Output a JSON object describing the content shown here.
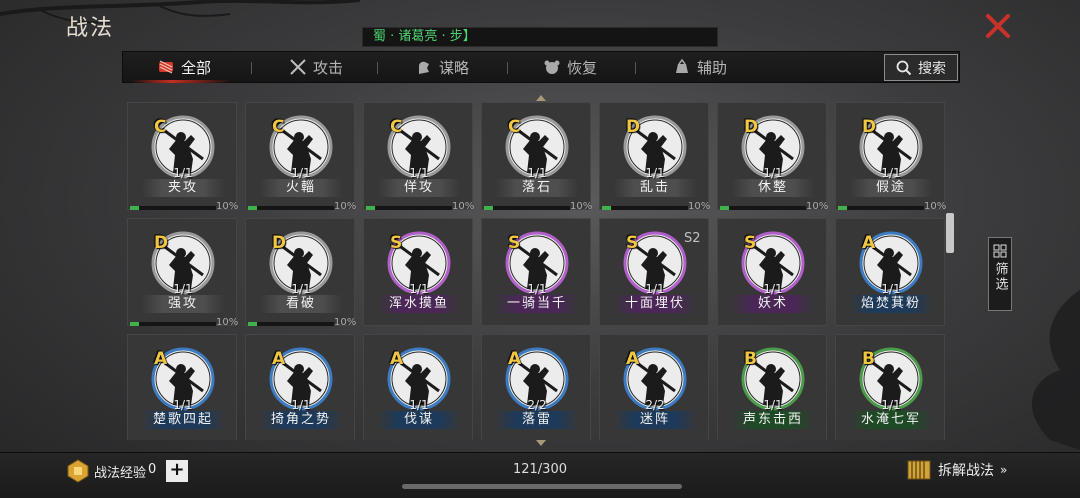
{
  "header": {
    "title": "战法",
    "hero_banner": "蜀 · 诸葛亮 · 步】"
  },
  "tabs": [
    {
      "label": "全部",
      "icon": "scroll-bundle-icon",
      "active": true
    },
    {
      "label": "攻击",
      "icon": "crossed-swords-icon",
      "active": false
    },
    {
      "label": "谋略",
      "icon": "hand-scroll-icon",
      "active": false
    },
    {
      "label": "恢复",
      "icon": "bear-head-icon",
      "active": false
    },
    {
      "label": "辅助",
      "icon": "pouch-icon",
      "active": false
    }
  ],
  "search": {
    "label": "搜索"
  },
  "filter": {
    "label": "筛选"
  },
  "colors": {
    "grade": "#f0c642",
    "ring_plain": "#9a9a9a",
    "ring_s": "#b060c8",
    "ring_a": "#3d7bc0",
    "ring_b": "#4a9a4a",
    "xp_fill": "#3fb34a",
    "close": "#c8322a"
  },
  "skills": [
    {
      "grade": "C",
      "count": "1/1",
      "name": "夹攻",
      "xp_label": "10%",
      "xp": 0.1,
      "quality": "plain",
      "season": ""
    },
    {
      "grade": "C",
      "count": "1/1",
      "name": "火輜",
      "xp_label": "10%",
      "xp": 0.1,
      "quality": "plain",
      "season": ""
    },
    {
      "grade": "C",
      "count": "1/1",
      "name": "佯攻",
      "xp_label": "10%",
      "xp": 0.1,
      "quality": "plain",
      "season": ""
    },
    {
      "grade": "C",
      "count": "1/1",
      "name": "落石",
      "xp_label": "10%",
      "xp": 0.1,
      "quality": "plain",
      "season": ""
    },
    {
      "grade": "D",
      "count": "1/1",
      "name": "乱击",
      "xp_label": "10%",
      "xp": 0.1,
      "quality": "plain",
      "season": ""
    },
    {
      "grade": "D",
      "count": "1/1",
      "name": "休整",
      "xp_label": "10%",
      "xp": 0.1,
      "quality": "plain",
      "season": ""
    },
    {
      "grade": "D",
      "count": "1/1",
      "name": "假途",
      "xp_label": "10%",
      "xp": 0.1,
      "quality": "plain",
      "season": ""
    },
    {
      "grade": "D",
      "count": "1/1",
      "name": "强攻",
      "xp_label": "10%",
      "xp": 0.1,
      "quality": "plain",
      "season": ""
    },
    {
      "grade": "D",
      "count": "1/1",
      "name": "看破",
      "xp_label": "10%",
      "xp": 0.1,
      "quality": "plain",
      "season": ""
    },
    {
      "grade": "S",
      "count": "1/1",
      "name": "浑水摸鱼",
      "xp_label": "",
      "xp": null,
      "quality": "s",
      "season": ""
    },
    {
      "grade": "S",
      "count": "1/1",
      "name": "一骑当千",
      "xp_label": "",
      "xp": null,
      "quality": "s",
      "season": ""
    },
    {
      "grade": "S",
      "count": "1/1",
      "name": "十面埋伏",
      "xp_label": "",
      "xp": null,
      "quality": "s",
      "season": "S2"
    },
    {
      "grade": "S",
      "count": "1/1",
      "name": "妖术",
      "xp_label": "",
      "xp": null,
      "quality": "s",
      "season": ""
    },
    {
      "grade": "A",
      "count": "1/1",
      "name": "焰焚萁粉",
      "xp_label": "",
      "xp": null,
      "quality": "a",
      "season": ""
    },
    {
      "grade": "A",
      "count": "1/1",
      "name": "楚歌四起",
      "xp_label": "",
      "xp": null,
      "quality": "a",
      "season": ""
    },
    {
      "grade": "A",
      "count": "1/1",
      "name": "掎角之势",
      "xp_label": "",
      "xp": null,
      "quality": "a",
      "season": ""
    },
    {
      "grade": "A",
      "count": "1/1",
      "name": "伐谋",
      "xp_label": "",
      "xp": null,
      "quality": "a",
      "season": ""
    },
    {
      "grade": "A",
      "count": "2/2",
      "name": "落雷",
      "xp_label": "",
      "xp": null,
      "quality": "a",
      "season": ""
    },
    {
      "grade": "A",
      "count": "2/2",
      "name": "迷阵",
      "xp_label": "",
      "xp": null,
      "quality": "a",
      "season": ""
    },
    {
      "grade": "B",
      "count": "1/1",
      "name": "声东击西",
      "xp_label": "",
      "xp": null,
      "quality": "b",
      "season": ""
    },
    {
      "grade": "B",
      "count": "1/1",
      "name": "水淹七军",
      "xp_label": "",
      "xp": null,
      "quality": "b",
      "season": ""
    }
  ],
  "footer": {
    "exp_label": "战法经验",
    "exp_value": "0",
    "capacity": "121/300",
    "dismantle_label": "拆解战法",
    "dismantle_chevron": "»"
  }
}
